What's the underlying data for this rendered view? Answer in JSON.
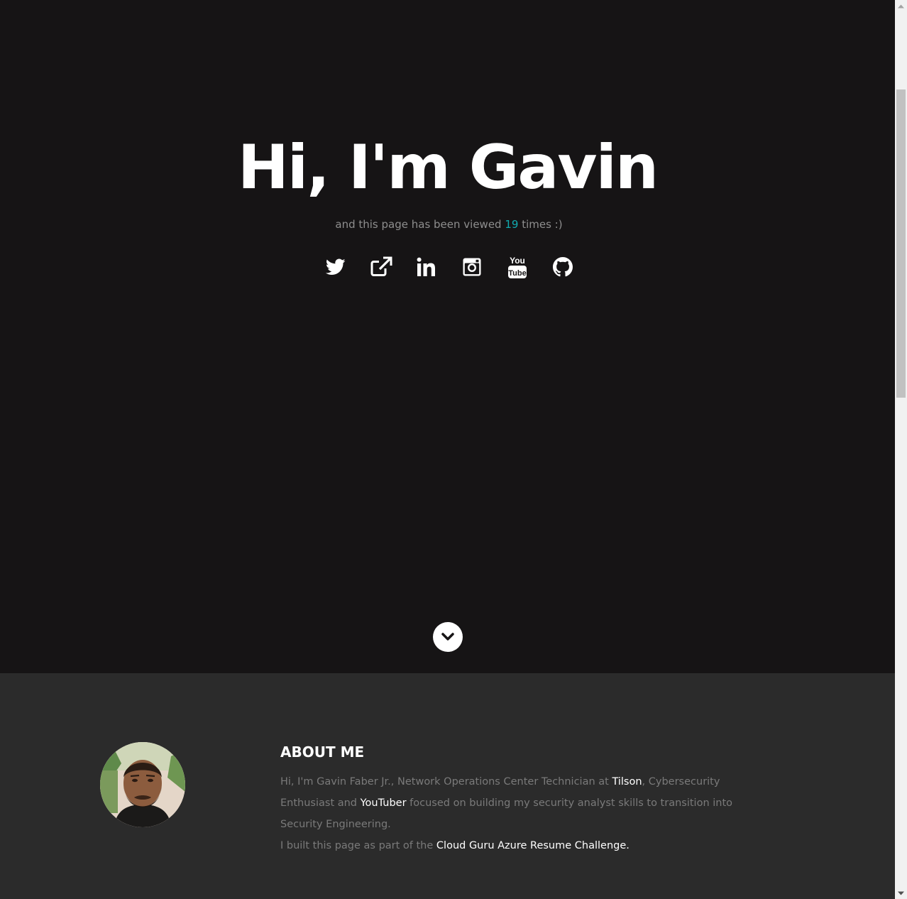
{
  "hero": {
    "title": "Hi, I'm Gavin",
    "subtitle_prefix": "and this page has been viewed ",
    "view_count": "19",
    "subtitle_suffix": " times :)",
    "count_color": "#11abb0",
    "social_icons": [
      "twitter-icon",
      "external-link-icon",
      "linkedin-icon",
      "instagram-icon",
      "youtube-icon",
      "github-icon"
    ]
  },
  "scroll_down": {
    "icon": "chevron-down-icon"
  },
  "about": {
    "heading": "ABOUT ME",
    "p1_part1": "Hi, I'm Gavin Faber Jr., Network Operations Center Technician at ",
    "p1_link1": "Tilson",
    "p1_part2": ", Cybersecurity Enthusiast and ",
    "p1_link2": "YouTuber",
    "p1_part3": " focused on building my security analyst skills to transition into Security Engineering.",
    "p2_part1": "I built this page as part of the ",
    "p2_link": "Cloud Guru Azure Resume Challenge."
  },
  "colors": {
    "hero_bg": "#161415",
    "about_bg": "#2b2b2b",
    "accent": "#11abb0"
  }
}
